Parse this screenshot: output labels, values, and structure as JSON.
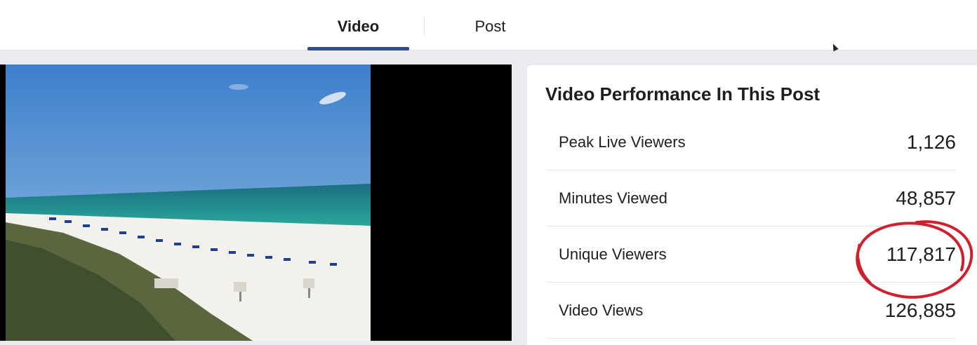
{
  "tabs": [
    {
      "label": "Video",
      "active": true
    },
    {
      "label": "Post",
      "active": false
    }
  ],
  "video": {
    "description_icon": "video-player"
  },
  "panel": {
    "title": "Video Performance In This Post",
    "rows": [
      {
        "label": "Peak Live Viewers",
        "value": "1,126"
      },
      {
        "label": "Minutes Viewed",
        "value": "48,857"
      },
      {
        "label": "Unique Viewers",
        "value": "117,817",
        "highlighted": true
      },
      {
        "label": "Video Views",
        "value": "126,885"
      }
    ]
  },
  "colors": {
    "active_tab_underline": "#2d4f8e",
    "highlight_circle": "#d0202e",
    "page_background": "#e9ebee"
  }
}
